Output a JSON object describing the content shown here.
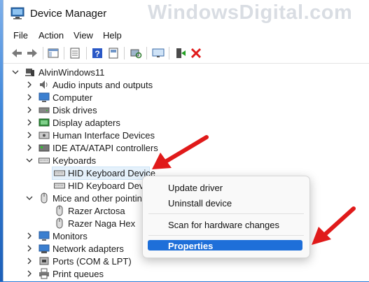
{
  "window": {
    "title": "Device Manager",
    "watermark": "WindowsDigital.com"
  },
  "menu": {
    "file": "File",
    "action": "Action",
    "view": "View",
    "help": "Help"
  },
  "toolbar": {
    "icons": [
      "back-arrow-icon",
      "forward-arrow-icon",
      "show-hide-console-tree-icon",
      "properties-sheet-icon",
      "help-icon",
      "scan-hardware-icon",
      "update-driver-monitor-icon",
      "enable-device-icon",
      "uninstall-x-icon"
    ]
  },
  "tree": {
    "root": "AlvinWindows11",
    "items": [
      {
        "label": "Audio inputs and outputs",
        "icon": "speaker-icon",
        "expanded": false
      },
      {
        "label": "Computer",
        "icon": "computer-icon",
        "expanded": false
      },
      {
        "label": "Disk drives",
        "icon": "disk-drive-icon",
        "expanded": false
      },
      {
        "label": "Display adapters",
        "icon": "display-adapter-icon",
        "expanded": false
      },
      {
        "label": "Human Interface Devices",
        "icon": "hid-icon",
        "expanded": false
      },
      {
        "label": "IDE ATA/ATAPI controllers",
        "icon": "ide-controller-icon",
        "expanded": false
      },
      {
        "label": "Keyboards",
        "icon": "keyboard-icon",
        "expanded": true
      },
      {
        "label": "Mice and other pointing devices",
        "icon": "mouse-icon",
        "expanded": true
      },
      {
        "label": "Monitors",
        "icon": "monitor-icon",
        "expanded": false
      },
      {
        "label": "Network adapters",
        "icon": "network-adapter-icon",
        "expanded": false
      },
      {
        "label": "Ports (COM & LPT)",
        "icon": "port-icon",
        "expanded": false
      },
      {
        "label": "Print queues",
        "icon": "printer-icon",
        "expanded": false
      }
    ],
    "keyboards": [
      "HID Keyboard Device",
      "HID Keyboard Device"
    ],
    "mice": [
      "Razer Arctosa",
      "Razer Naga Hex"
    ]
  },
  "context_menu": {
    "items": [
      "Update driver",
      "Uninstall device",
      "Scan for hardware changes",
      "Properties"
    ],
    "highlighted": "Properties"
  },
  "colors": {
    "accent": "#1e6fd9",
    "annotation_arrow": "#e01a1a",
    "selection": "#e5f1fb"
  }
}
